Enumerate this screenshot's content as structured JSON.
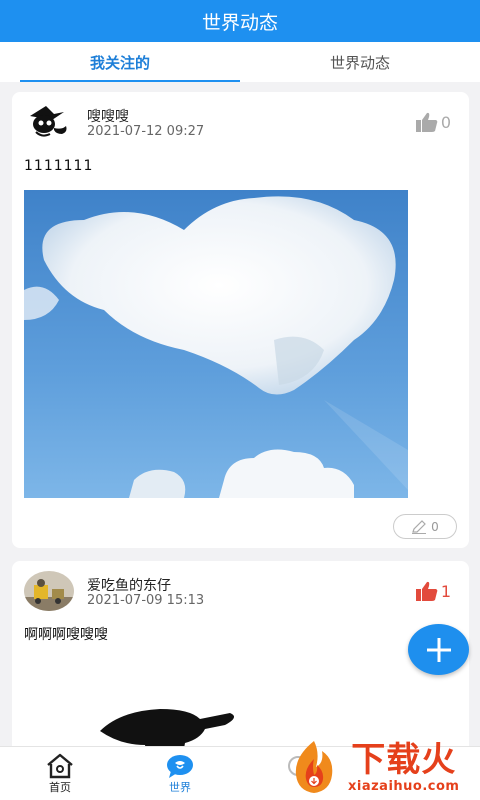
{
  "header": {
    "title": "世界动态"
  },
  "tabs": [
    {
      "label": "我关注的",
      "active": true
    },
    {
      "label": "世界动态",
      "active": false
    }
  ],
  "posts": [
    {
      "username": "嗖嗖嗖",
      "time": "2021-07-12 09:27",
      "like_count": "0",
      "liked": false,
      "text": "1111111",
      "image": "heart-shaped-cloud-in-blue-sky",
      "comment_count": "0"
    },
    {
      "username": "爱吃鱼的东仔",
      "time": "2021-07-09 15:13",
      "like_count": "1",
      "liked": true,
      "text": "啊啊啊嗖嗖嗖",
      "image": "dark-silhouette"
    }
  ],
  "bottom_nav": [
    {
      "label": "首页",
      "icon": "home-icon",
      "active": false
    },
    {
      "label": "世界",
      "icon": "world-chat-icon",
      "active": true
    }
  ],
  "fab": {
    "icon": "plus-icon"
  },
  "watermark": {
    "text": "下载火",
    "url_text": "xiazaihuo.com"
  },
  "colors": {
    "primary": "#1e90f0",
    "like_active": "#e24a3c",
    "background": "#f2f2f4"
  }
}
